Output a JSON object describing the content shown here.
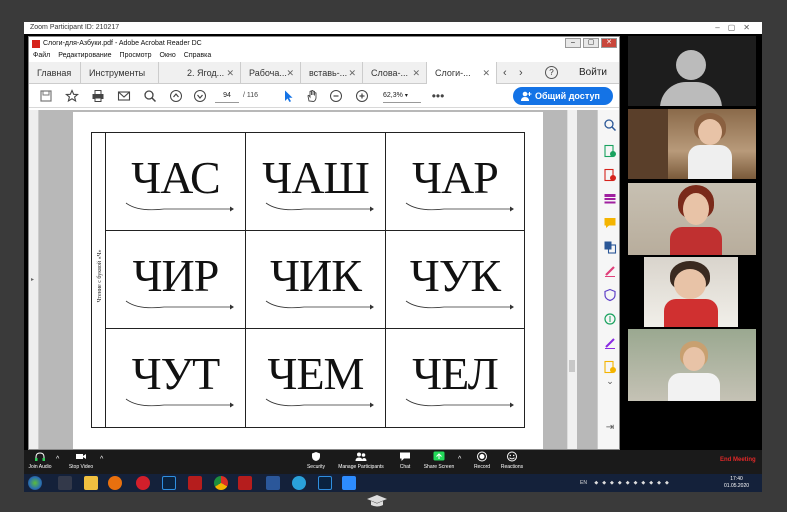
{
  "zoom_window": {
    "title": "Zoom Participant ID: 210217"
  },
  "acrobat": {
    "title": "Слоги-для-Азбуки.pdf - Adobe Acrobat Reader DC",
    "menu": [
      "Файл",
      "Редактирование",
      "Просмотр",
      "Окно",
      "Справка"
    ],
    "tabs": [
      {
        "label": "Главная"
      },
      {
        "label": "Инструменты"
      },
      {
        "label": "2. Ягод..."
      },
      {
        "label": "Рабоча..."
      },
      {
        "label": "вставь-..."
      },
      {
        "label": "Слова-..."
      },
      {
        "label": "Слоги-..."
      }
    ],
    "login_label": "Войти",
    "help_label": "?",
    "page_current": "94",
    "page_total": "/ 116",
    "zoom_level": "62,3%",
    "share_button": "Общий доступ"
  },
  "document": {
    "side_label": "Чтение с буквой «Ч»",
    "syllables": [
      "ЧАС",
      "ЧАШ",
      "ЧАР",
      "ЧИР",
      "ЧИК",
      "ЧУК",
      "ЧУТ",
      "ЧЕМ",
      "ЧЕЛ"
    ]
  },
  "zoom_toolbar": {
    "join_audio": "Join Audio",
    "stop_video": "Stop Video",
    "security": "Security",
    "manage_participants": "Manage Participants",
    "chat": "Chat",
    "share_screen": "Share Screen",
    "record": "Record",
    "reactions": "Reactions",
    "end_meeting": "End Meeting"
  },
  "taskbar": {
    "lang": "EN",
    "time": "17:40",
    "date": "01.05.2020"
  },
  "colors": {
    "acrobat_blue": "#1473e6",
    "pdf_red": "#d6231c",
    "end_meeting_red": "#e02828",
    "share_green": "#23d959"
  }
}
